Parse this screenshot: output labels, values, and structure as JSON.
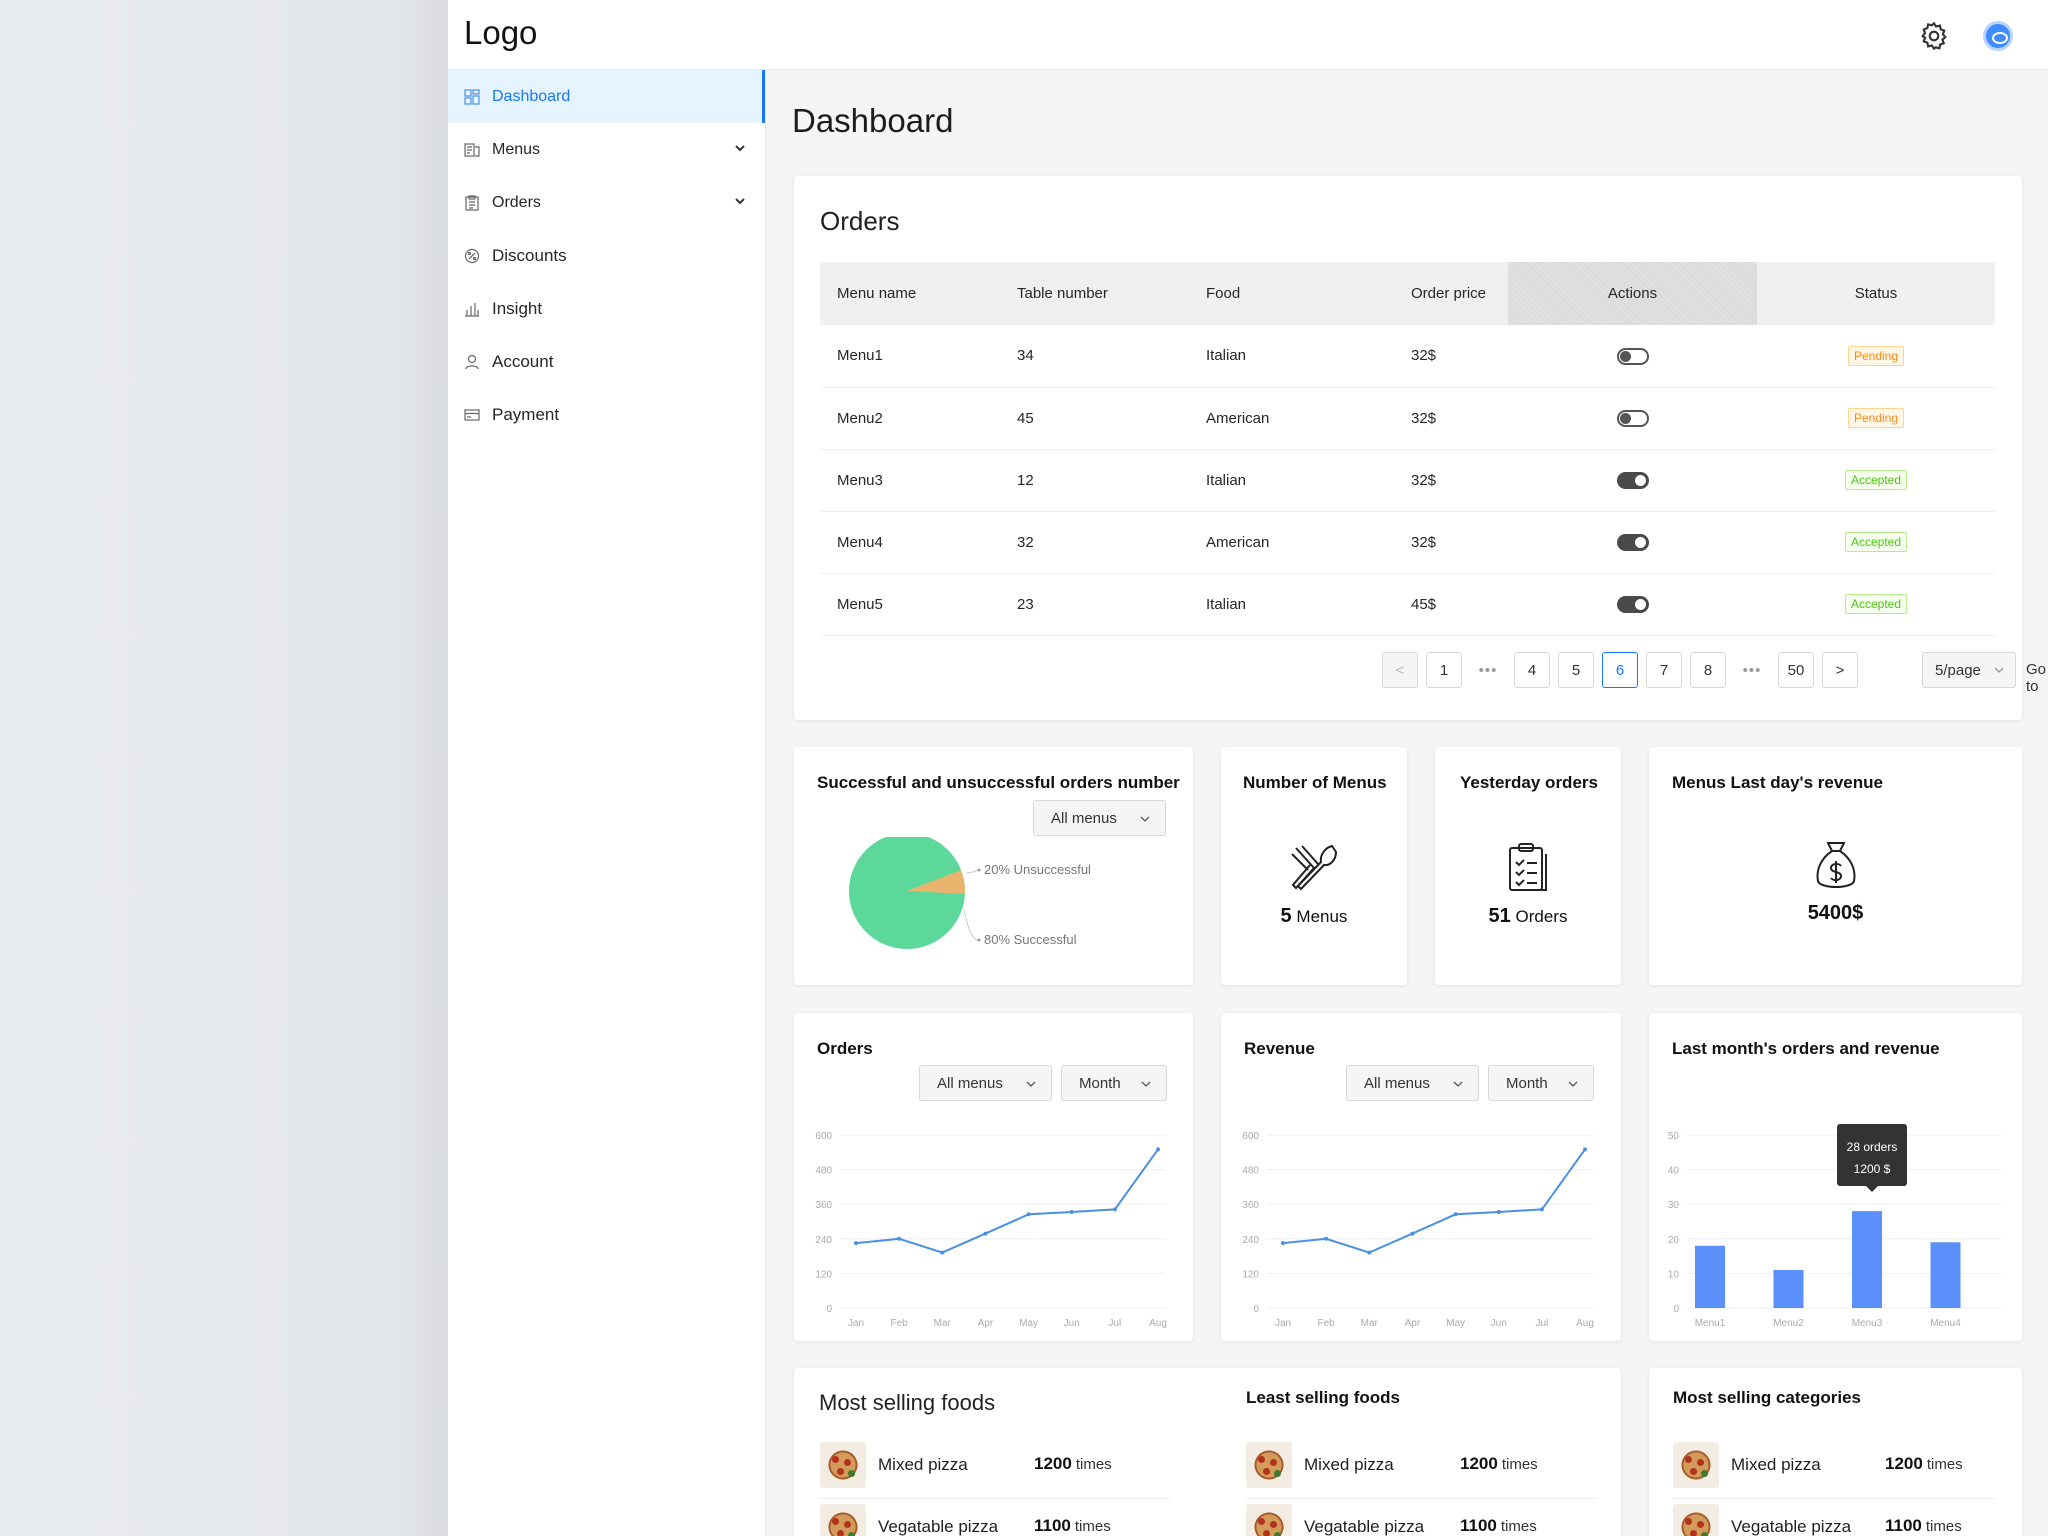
{
  "header": {
    "logo": "Logo",
    "settings_icon": "gear-icon",
    "avatar_icon": "user-avatar"
  },
  "sidebar": {
    "items": [
      {
        "label": "Dashboard",
        "icon": "dashboard-icon",
        "active": true
      },
      {
        "label": "Menus",
        "icon": "menu-book-icon",
        "expandable": true
      },
      {
        "label": "Orders",
        "icon": "clipboard-icon",
        "expandable": true
      },
      {
        "label": "Discounts",
        "icon": "discount-icon"
      },
      {
        "label": "Insight",
        "icon": "bar-chart-icon"
      },
      {
        "label": "Account",
        "icon": "user-icon"
      },
      {
        "label": "Payment",
        "icon": "card-icon"
      }
    ]
  },
  "page": {
    "title": "Dashboard"
  },
  "orders_table": {
    "title": "Orders",
    "columns": [
      "Menu name",
      "Table number",
      "Food",
      "Order price",
      "Actions",
      "Status"
    ],
    "rows": [
      {
        "menu": "Menu1",
        "table": "34",
        "food": "Italian",
        "price": "32$",
        "toggle": "off",
        "status": "Pending"
      },
      {
        "menu": "Menu2",
        "table": "45",
        "food": "American",
        "price": "32$",
        "toggle": "off",
        "status": "Pending"
      },
      {
        "menu": "Menu3",
        "table": "12",
        "food": "Italian",
        "price": "32$",
        "toggle": "on",
        "status": "Accepted"
      },
      {
        "menu": "Menu4",
        "table": "32",
        "food": "American",
        "price": "32$",
        "toggle": "on",
        "status": "Accepted"
      },
      {
        "menu": "Menu5",
        "table": "23",
        "food": "Italian",
        "price": "45$",
        "toggle": "on",
        "status": "Accepted"
      }
    ],
    "pagination": {
      "prev": "<",
      "next": ">",
      "pages": [
        "1",
        "•••",
        "4",
        "5",
        "6",
        "7",
        "8",
        "•••",
        "50"
      ],
      "current": "6",
      "page_size": "5/page",
      "goto_label": "Go to",
      "goto_value": ""
    }
  },
  "pie_card": {
    "title": "Successful and unsuccessful orders number",
    "filter": "All menus",
    "labels": {
      "unsuccessful": "20% Unsuccessful",
      "successful": "80% Successful"
    },
    "colors": {
      "successful": "#5dd89b",
      "unsuccessful": "#ebb46e"
    }
  },
  "stats": {
    "menus": {
      "title": "Number of Menus",
      "value": "5",
      "unit": "Menus",
      "icon": "fork-knife-icon"
    },
    "yesterday": {
      "title": "Yesterday orders",
      "value": "51",
      "unit": "Orders",
      "icon": "clipboard-list-icon"
    },
    "revenue": {
      "title": "Menus Last day's revenue",
      "value": "5400$",
      "icon": "money-bag-icon"
    }
  },
  "orders_chart_card": {
    "title": "Orders",
    "filter_menu": "All menus",
    "filter_period": "Month"
  },
  "revenue_chart_card": {
    "title": "Revenue",
    "filter_menu": "All menus",
    "filter_period": "Month"
  },
  "last_month_card": {
    "title": "Last month's orders and revenue",
    "tooltip": {
      "line1": "28 orders",
      "line2": "1200 $"
    }
  },
  "chart_data": [
    {
      "type": "line",
      "x": [
        "Jan",
        "Feb",
        "Mar",
        "Apr",
        "May",
        "Jun",
        "Jul",
        "Aug"
      ],
      "values": [
        225,
        240,
        192,
        258,
        325,
        333,
        342,
        550
      ],
      "ylim": [
        0,
        600
      ],
      "yticks": [
        0,
        120,
        240,
        360,
        480,
        600
      ],
      "color": "#4a90e2"
    },
    {
      "type": "line",
      "x": [
        "Jan",
        "Feb",
        "Mar",
        "Apr",
        "May",
        "Jun",
        "Jul",
        "Aug"
      ],
      "values": [
        225,
        240,
        192,
        258,
        325,
        333,
        342,
        550
      ],
      "ylim": [
        0,
        600
      ],
      "yticks": [
        0,
        120,
        240,
        360,
        480,
        600
      ],
      "color": "#4a90e2"
    },
    {
      "type": "bar",
      "categories": [
        "Menu1",
        "Menu2",
        "Menu3",
        "Menu4"
      ],
      "values": [
        18,
        11,
        28,
        19
      ],
      "ylim": [
        0,
        50
      ],
      "yticks": [
        0,
        10,
        20,
        30,
        40,
        50
      ],
      "color": "#5b8ff9"
    },
    {
      "type": "pie",
      "categories": [
        "Successful",
        "Unsuccessful"
      ],
      "values": [
        80,
        20
      ]
    }
  ],
  "most_selling_foods": {
    "title": "Most selling foods",
    "items": [
      {
        "name": "Mixed pizza",
        "count": "1200",
        "unit": "times"
      },
      {
        "name": "Vegatable pizza",
        "count": "1100",
        "unit": "times"
      }
    ]
  },
  "least_selling_foods": {
    "title": "Least selling foods",
    "items": [
      {
        "name": "Mixed pizza",
        "count": "1200",
        "unit": "times"
      },
      {
        "name": "Vegatable pizza",
        "count": "1100",
        "unit": "times"
      }
    ]
  },
  "most_selling_categories": {
    "title": "Most selling categories",
    "items": [
      {
        "name": "Mixed pizza",
        "count": "1200",
        "unit": "times"
      },
      {
        "name": "Vegatable pizza",
        "count": "1100",
        "unit": "times"
      }
    ]
  }
}
